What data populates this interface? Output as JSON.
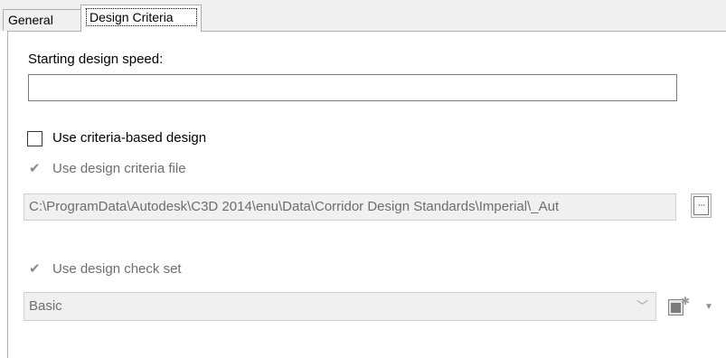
{
  "tabs": [
    {
      "label": "General",
      "active": false
    },
    {
      "label": "Design Criteria",
      "active": true
    }
  ],
  "form": {
    "starting_speed_label": "Starting design speed:",
    "starting_speed_value": "",
    "criteria_based": {
      "label": "Use criteria-based design",
      "checked": false,
      "enabled": true
    },
    "criteria_file": {
      "label": "Use design criteria file",
      "checked": true,
      "enabled": false
    },
    "criteria_file_path": "C:\\ProgramData\\Autodesk\\C3D 2014\\enu\\Data\\Corridor Design Standards\\Imperial\\_Aut",
    "browse_button_label": "···",
    "check_set": {
      "label": "Use design check set",
      "checked": true,
      "enabled": false
    },
    "check_set_selected": "Basic"
  },
  "icons": {
    "checkmark": "check-icon",
    "combo_arrow": "chevron-down-icon",
    "new_set": "new-document-icon",
    "dropdown": "caret-down-icon"
  },
  "colors": {
    "disabled_text": "#6d6d6d",
    "disabled_fill": "#f0f0f0",
    "tab_border": "#adadad"
  }
}
